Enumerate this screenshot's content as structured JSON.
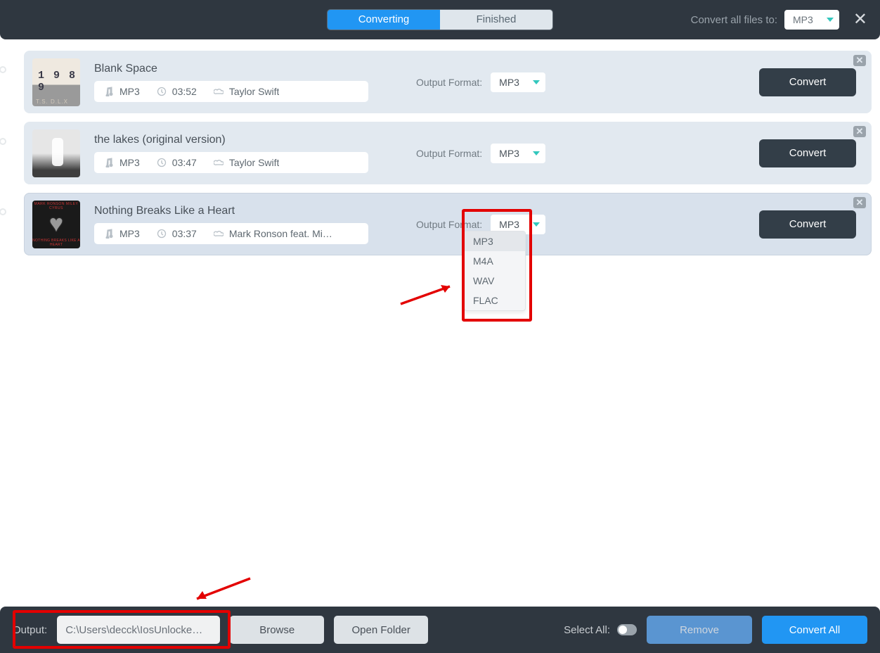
{
  "top": {
    "tabs": {
      "converting": "Converting",
      "finished": "Finished"
    },
    "convert_all_label": "Convert all files to:",
    "global_format": "MP3"
  },
  "tracks": [
    {
      "title": "Blank Space",
      "format": "MP3",
      "duration": "03:52",
      "artist": "Taylor Swift",
      "output_label": "Output Format:",
      "output_selected": "MP3",
      "convert_label": "Convert",
      "cover": "c1"
    },
    {
      "title": "the lakes (original version)",
      "format": "MP3",
      "duration": "03:47",
      "artist": "Taylor Swift",
      "output_label": "Output Format:",
      "output_selected": "MP3",
      "convert_label": "Convert",
      "cover": "c2"
    },
    {
      "title": "Nothing Breaks Like a Heart",
      "format": "MP3",
      "duration": "03:37",
      "artist": "Mark Ronson feat. Mil…",
      "output_label": "Output Format:",
      "output_selected": "MP3",
      "convert_label": "Convert",
      "cover": "c3"
    }
  ],
  "format_options": [
    "MP3",
    "M4A",
    "WAV",
    "FLAC"
  ],
  "bottom": {
    "output_label": "Output:",
    "output_path": "C:\\Users\\decck\\IosUnlocke…",
    "browse": "Browse",
    "open_folder": "Open Folder",
    "select_all": "Select All:",
    "remove": "Remove",
    "convert_all": "Convert All"
  }
}
